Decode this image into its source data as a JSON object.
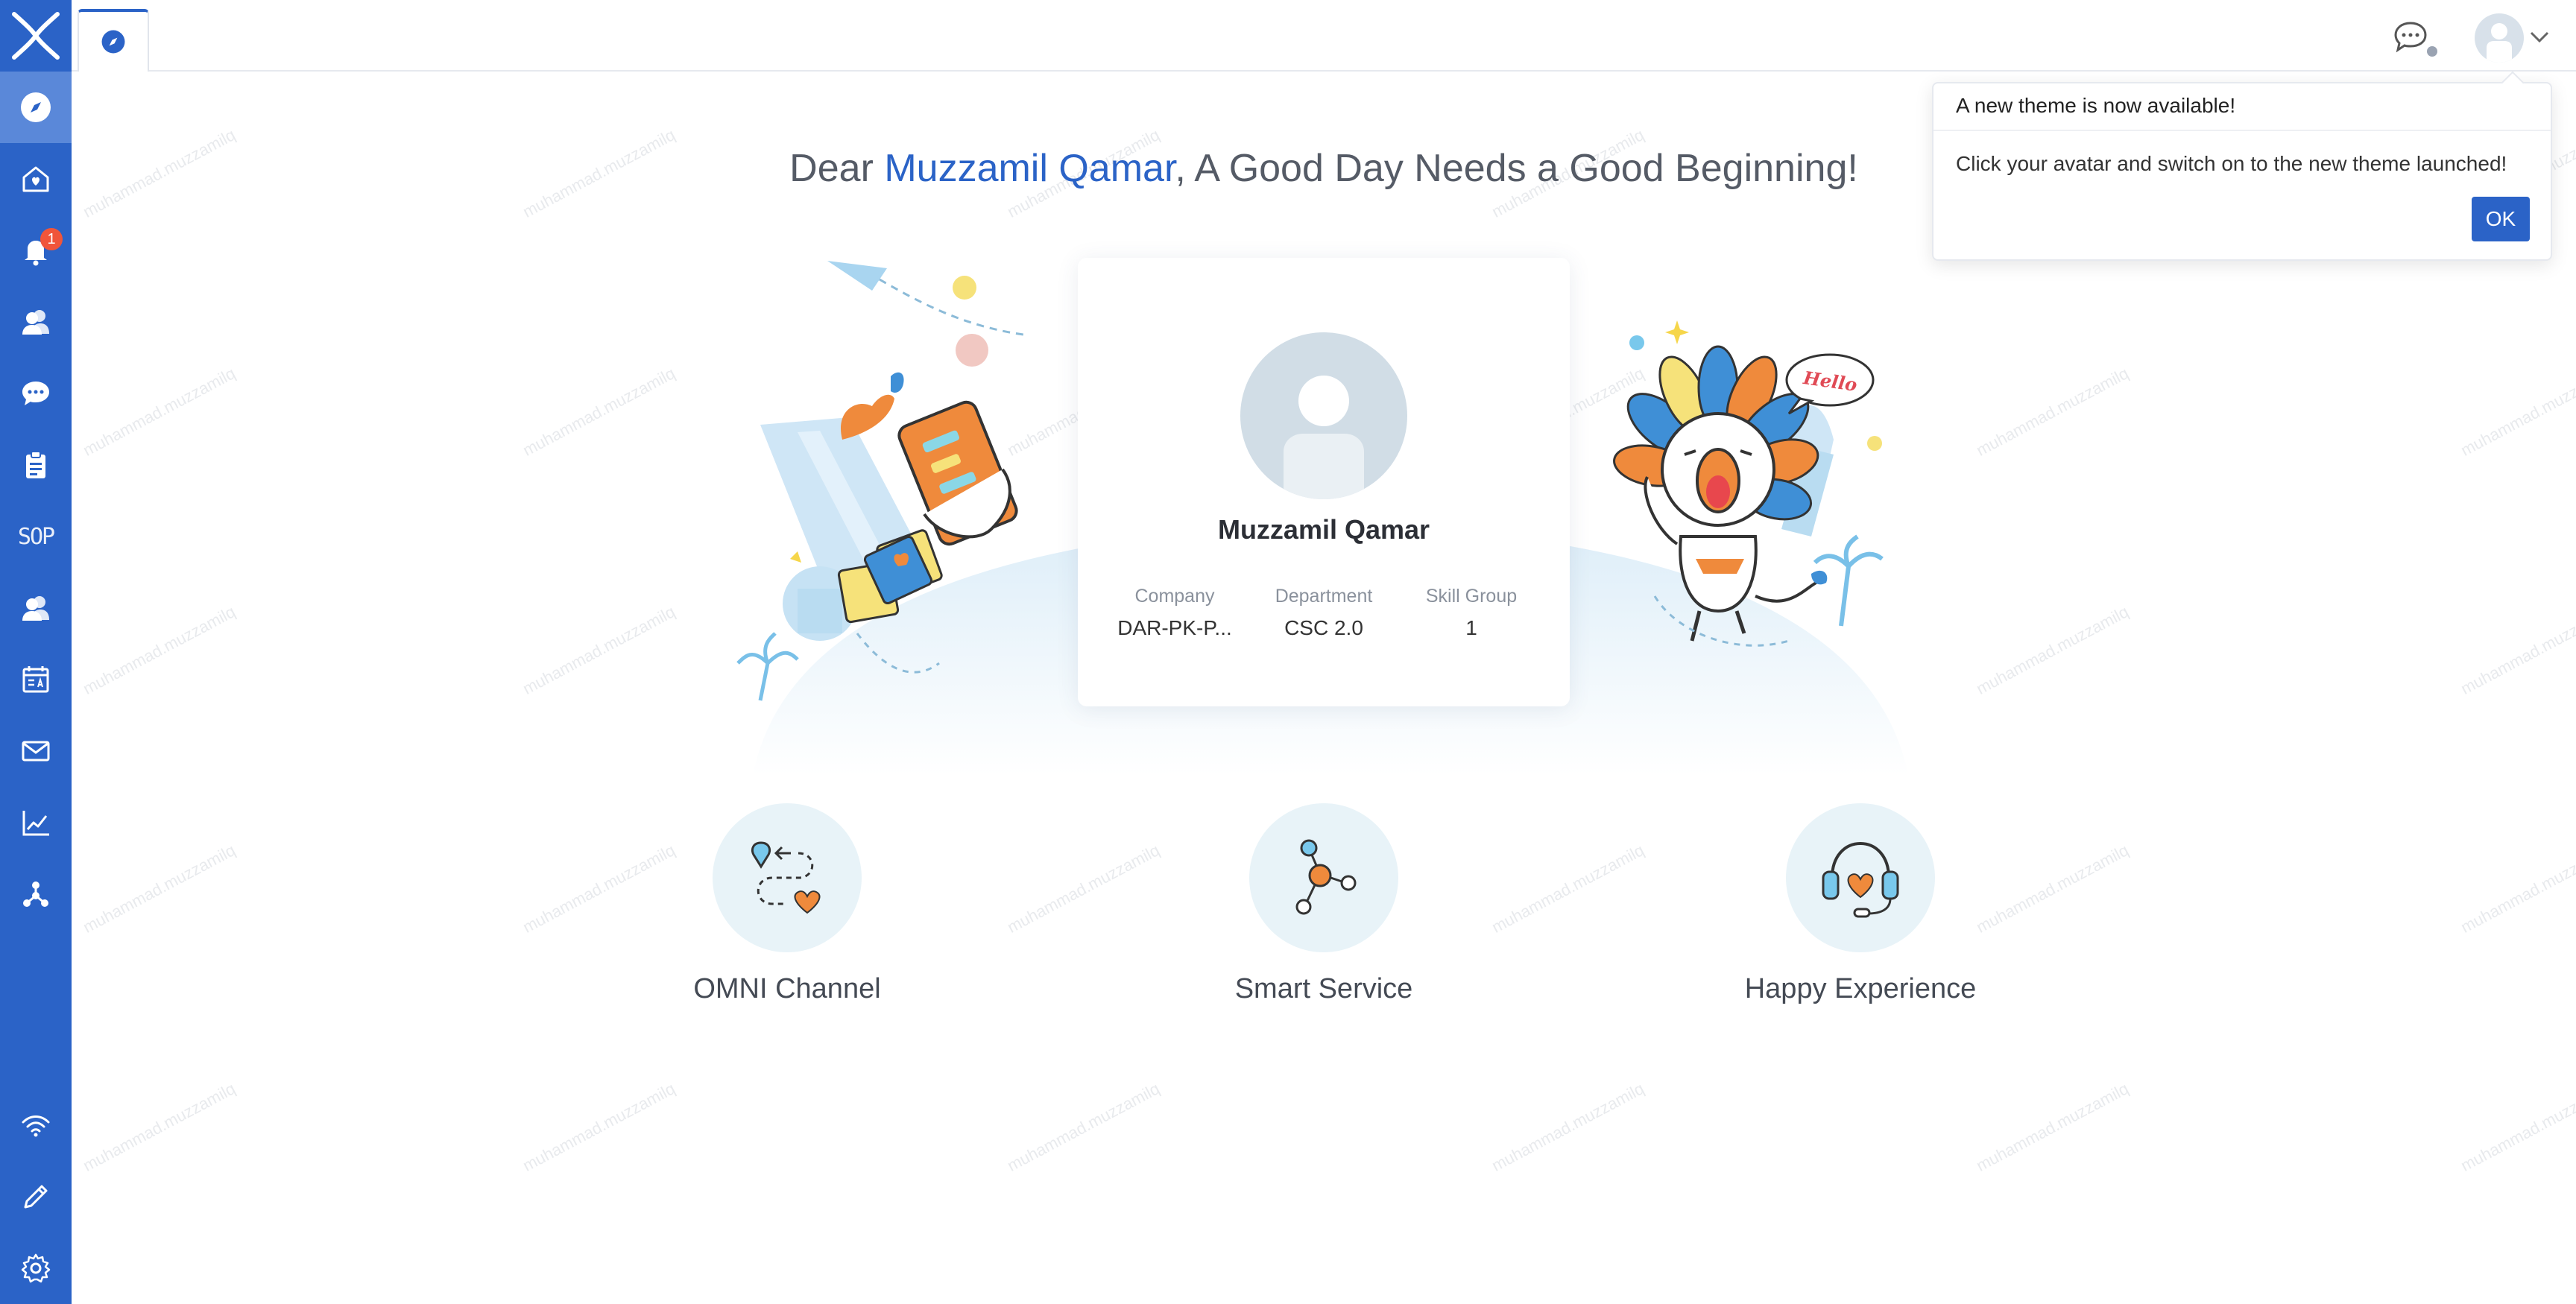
{
  "sidebar": {
    "items": [
      {
        "name": "dashboard",
        "icon": "compass-icon",
        "active": true
      },
      {
        "name": "home",
        "icon": "home-heart-icon"
      },
      {
        "name": "notifications",
        "icon": "bell-icon",
        "badge": "1"
      },
      {
        "name": "contacts",
        "icon": "users-icon"
      },
      {
        "name": "chat",
        "icon": "chat-bubble-icon"
      },
      {
        "name": "tickets",
        "icon": "clipboard-icon"
      },
      {
        "name": "sop",
        "icon": "sop-icon",
        "label": "SOP"
      },
      {
        "name": "agents",
        "icon": "users-icon"
      },
      {
        "name": "schedule",
        "icon": "calendar-icon"
      },
      {
        "name": "email",
        "icon": "mail-icon"
      },
      {
        "name": "reports",
        "icon": "chart-icon"
      },
      {
        "name": "integration",
        "icon": "network-icon"
      },
      {
        "name": "signal",
        "icon": "wifi-icon"
      },
      {
        "name": "edit",
        "icon": "pencil-icon"
      },
      {
        "name": "settings",
        "icon": "gear-icon"
      }
    ]
  },
  "greeting": {
    "prefix": "Dear ",
    "name": "Muzzamil Qamar",
    "suffix": ", A Good Day Needs a Good Beginning!"
  },
  "profile": {
    "name": "Muzzamil Qamar",
    "company_label": "Company",
    "company_value": "DAR-PK-P...",
    "department_label": "Department",
    "department_value": "CSC 2.0",
    "skill_group_label": "Skill Group",
    "skill_group_value": "1"
  },
  "illustration": {
    "hello_text": "Hello"
  },
  "features": [
    {
      "label": "OMNI Channel",
      "icon": "route-heart-icon"
    },
    {
      "label": "Smart Service",
      "icon": "network-nodes-icon"
    },
    {
      "label": "Happy Experience",
      "icon": "headset-heart-icon"
    }
  ],
  "popover": {
    "title": "A new theme is now available!",
    "body": "Click your avatar and switch on to the new theme launched!",
    "ok_label": "OK"
  },
  "watermark": "muhammad.muzzamilq",
  "colors": {
    "sidebar": "#2b63c7",
    "accent": "#2b63c7",
    "badge": "#f0553a",
    "orange": "#ef8a3c"
  }
}
